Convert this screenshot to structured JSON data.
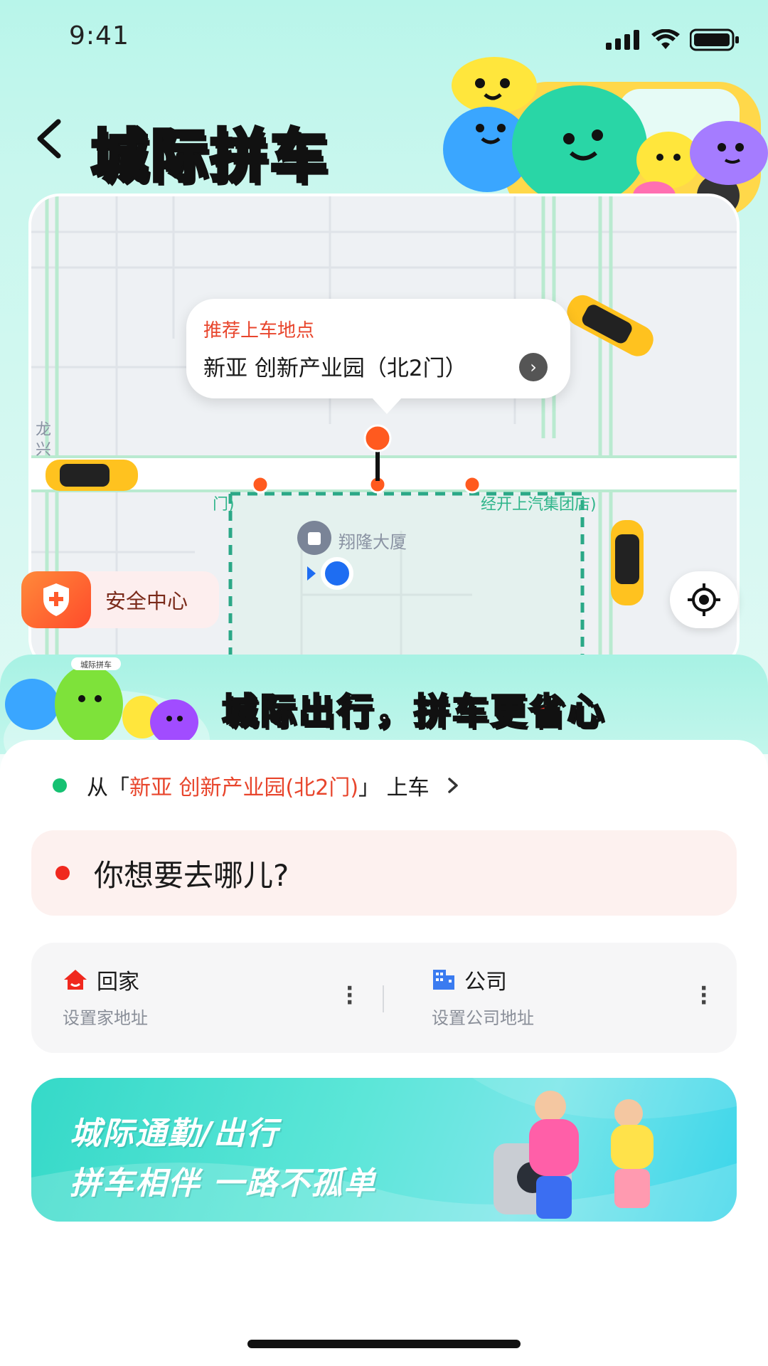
{
  "status_bar": {
    "time": "9:41"
  },
  "header": {
    "title": "城际拼车"
  },
  "map": {
    "pickup_bubble": {
      "label": "推荐上车地点",
      "place": "新亚 创新产业园（北2门）"
    },
    "road_labels": [
      "龙兴",
      "门)",
      "经开上汽集团店)"
    ],
    "poi": "翔隆大厦",
    "safety_center_label": "安全中心"
  },
  "slogan": {
    "prefix": "城际出行，拼车",
    "accent": "更省心"
  },
  "mascot_sign": "城际拼车",
  "from": {
    "prefix": "从「",
    "place": "新亚 创新产业园(北2门)",
    "suffix": "」 上车"
  },
  "destination": {
    "placeholder": "你想要去哪儿?"
  },
  "shortcuts": {
    "home": {
      "label": "回家",
      "sub": "设置家地址"
    },
    "work": {
      "label": "公司",
      "sub": "设置公司地址"
    }
  },
  "promo": {
    "line1": "城际通勤/出行",
    "line2": "拼车相伴 一路不孤单"
  },
  "colors": {
    "accent_red": "#e8452c",
    "pickup_green": "#16c172",
    "brand_teal": "#b8f5ea"
  },
  "icons": [
    "back-icon",
    "signal-icon",
    "wifi-icon",
    "battery-icon",
    "shield-icon",
    "locate-icon",
    "home-icon",
    "building-icon",
    "more-icon",
    "chevron-right-icon"
  ]
}
